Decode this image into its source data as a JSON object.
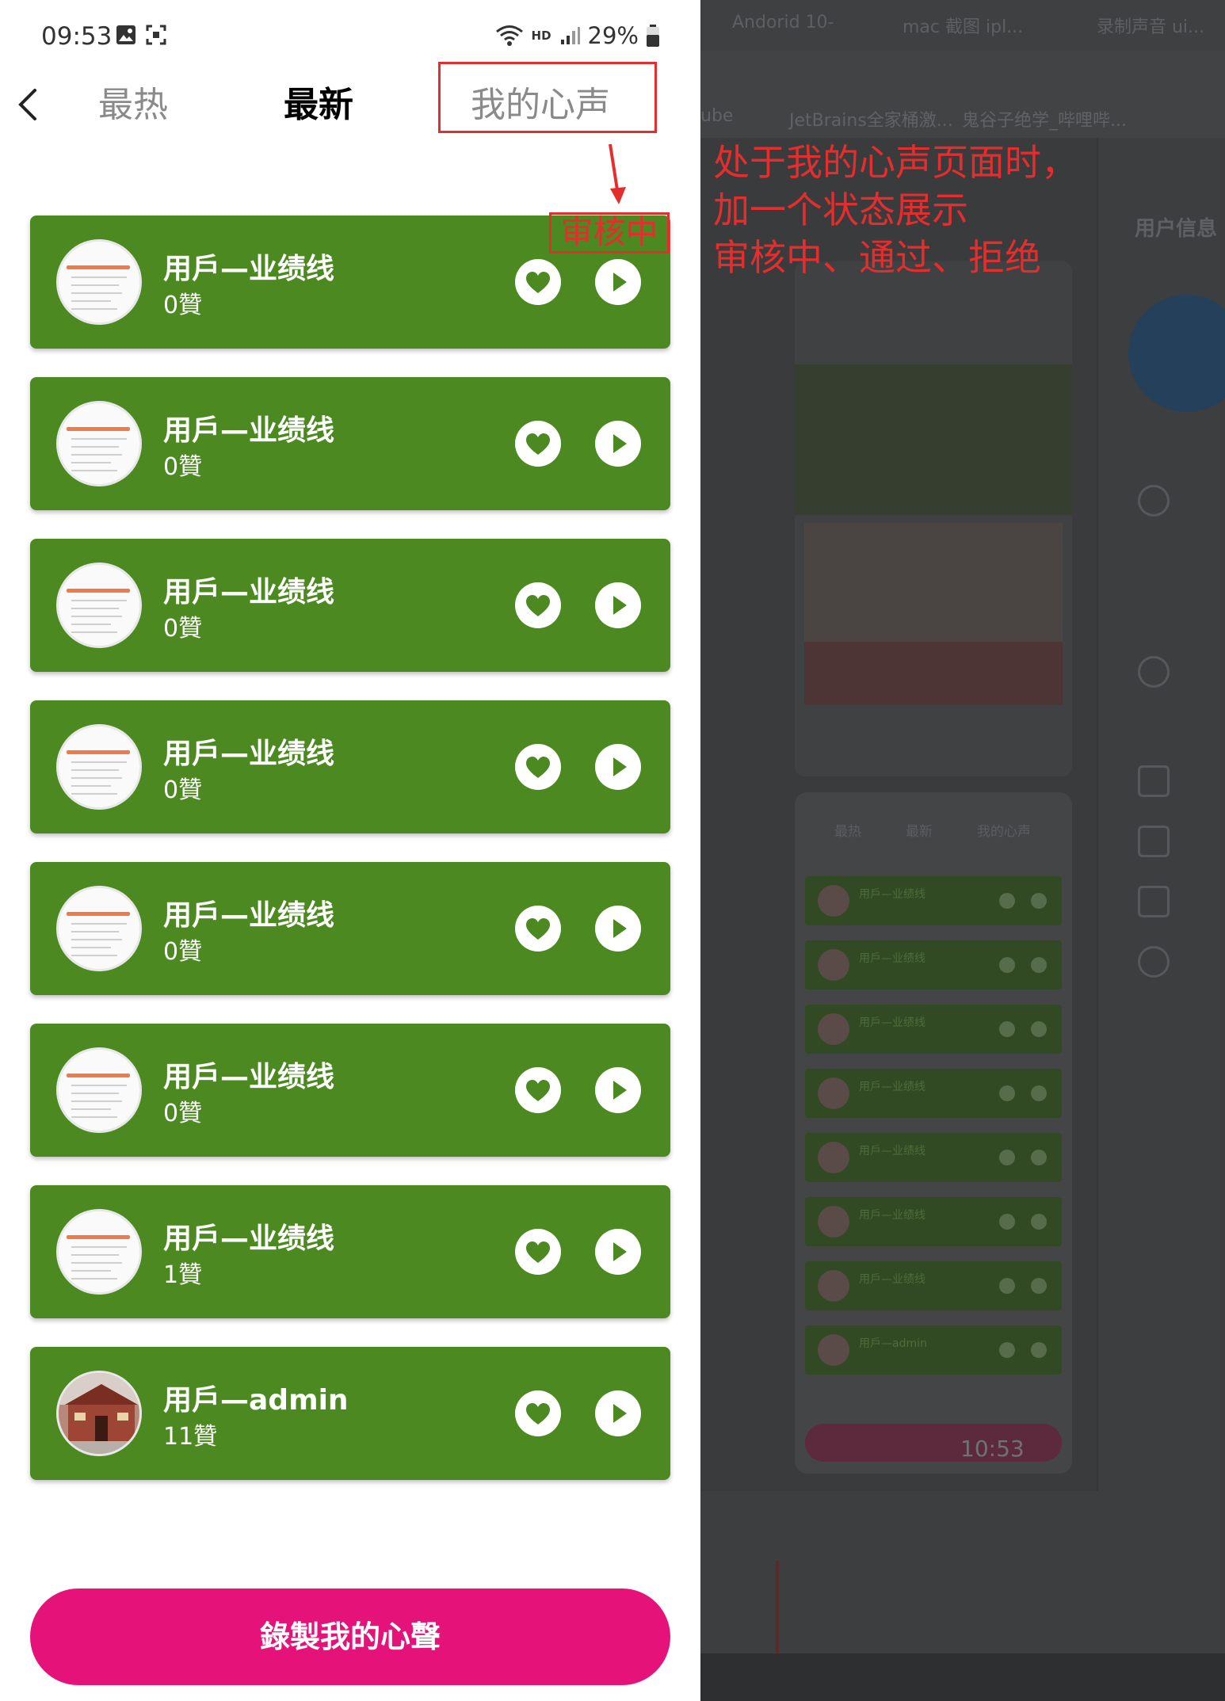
{
  "status_bar": {
    "time": "09:53",
    "network": "HD",
    "battery": "29%"
  },
  "tabs": [
    {
      "label": "最热",
      "active": false
    },
    {
      "label": "最新",
      "active": true
    },
    {
      "label": "我的心声",
      "active": false
    }
  ],
  "pending_badge": "审核中",
  "annotation": {
    "lines": [
      "处于我的心声页面时，",
      "加一个状态展示",
      "审核中、通过、拒绝"
    ],
    "color": "#e52d2d"
  },
  "voice_list": [
    {
      "name": "用戶—业绩线",
      "likes": "0贊",
      "avatar": "screenshot-thumbnail"
    },
    {
      "name": "用戶—业绩线",
      "likes": "0贊",
      "avatar": "screenshot-thumbnail"
    },
    {
      "name": "用戶—业绩线",
      "likes": "0贊",
      "avatar": "screenshot-thumbnail"
    },
    {
      "name": "用戶—业绩线",
      "likes": "0贊",
      "avatar": "screenshot-thumbnail"
    },
    {
      "name": "用戶—业绩线",
      "likes": "0贊",
      "avatar": "screenshot-thumbnail"
    },
    {
      "name": "用戶—业绩线",
      "likes": "0贊",
      "avatar": "screenshot-thumbnail"
    },
    {
      "name": "用戶—业绩线",
      "likes": "1贊",
      "avatar": "screenshot-thumbnail"
    },
    {
      "name": "用戶—admin",
      "likes": "11贊",
      "avatar": "building-photo"
    }
  ],
  "record_button": "錄製我的心聲",
  "icons": {
    "back": "chevron-left-icon",
    "like": "heart-icon",
    "play": "play-icon"
  },
  "colors": {
    "card_green": "#4c8a21",
    "record_pink": "#e5127a",
    "annotation_red": "#e52d2d",
    "desktop_dim": "#3b3c3e"
  },
  "background_desktop": {
    "browser_tabs": [
      "Andorid 10-",
      "mac 截图 ipl...",
      "录制声音 ui..."
    ],
    "bookmarks": [
      "ube",
      "JetBrains全家桶激...",
      "鬼谷子绝学_哔哩哔..."
    ],
    "side_panel_title": "用户信息",
    "mini_tabs": [
      "最热",
      "最新",
      "我的心声"
    ],
    "mini_rows": [
      "用戶—业绩线",
      "用戶—业绩线",
      "用戶—业绩线",
      "用戶—业绩线",
      "用戶—业绩线",
      "用戶—业绩线",
      "用戶—业绩线",
      "用戶—admin"
    ],
    "chat_time": "10:53"
  }
}
